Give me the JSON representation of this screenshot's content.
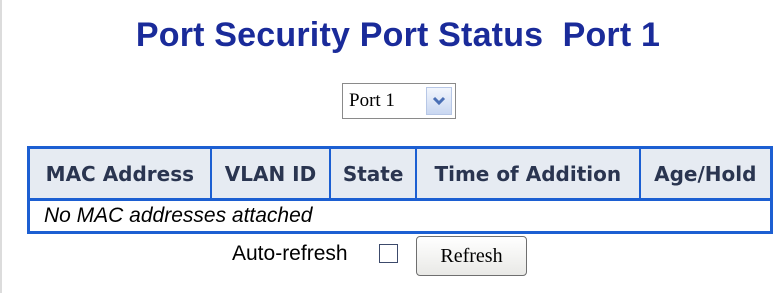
{
  "page": {
    "title": "Port Security Port Status  Port 1"
  },
  "port_selector": {
    "selected": "Port 1"
  },
  "table": {
    "columns": [
      "MAC Address",
      "VLAN ID",
      "State",
      "Time of Addition",
      "Age/Hold"
    ],
    "empty_message": "No MAC addresses attached"
  },
  "controls": {
    "auto_refresh_label": "Auto-refresh",
    "auto_refresh_checked": false,
    "refresh_label": "Refresh"
  },
  "icons": {
    "dropdown": "chevron-down-icon"
  },
  "colors": {
    "title": "#1a2b9a",
    "table_border": "#1c5fd2",
    "header_bg": "#e6ebf2"
  }
}
